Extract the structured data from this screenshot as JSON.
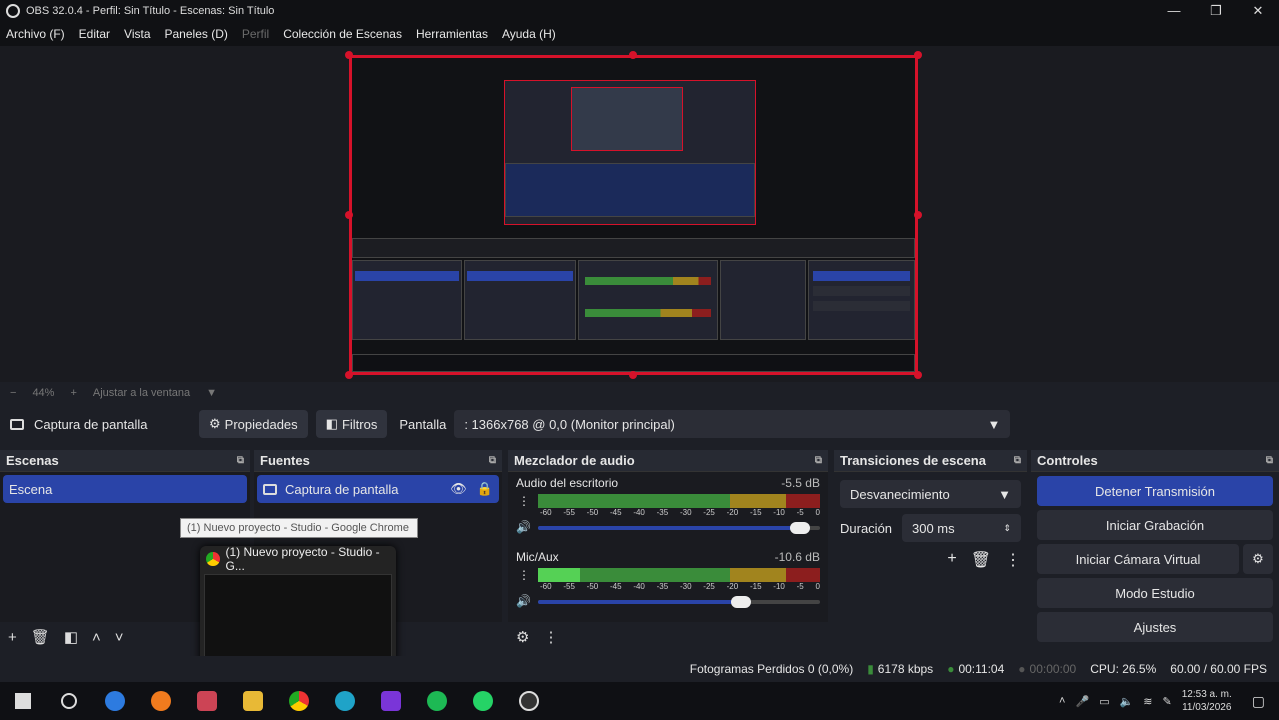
{
  "window": {
    "title": "OBS 32.0.4 - Perfil: Sin Título - Escenas: Sin Título",
    "controls": [
      "—",
      "❐",
      "✕"
    ]
  },
  "menu": {
    "items": [
      {
        "label": "Archivo (F)"
      },
      {
        "label": "Editar"
      },
      {
        "label": "Vista"
      },
      {
        "label": "Paneles (D)"
      },
      {
        "label": "Perfil"
      },
      {
        "label": "Colección de Escenas"
      },
      {
        "label": "Herramientas"
      },
      {
        "label": "Ayuda (H)"
      }
    ]
  },
  "preview": {
    "zoom_minus": "−",
    "zoom": "44%",
    "zoom_plus": "+",
    "fit": "Ajustar a la ventana",
    "accent": "#d6122a"
  },
  "sourcebar": {
    "source_name": "Captura de pantalla",
    "properties": "Propiedades",
    "filters": "Filtros",
    "screen_label": "Pantalla",
    "screen_value": ": 1366x768 @ 0,0 (Monitor principal)"
  },
  "docks": {
    "scenes": {
      "title": "Escenas",
      "items": [
        "Escena"
      ]
    },
    "sources": {
      "title": "Fuentes",
      "items": [
        "Captura de pantalla"
      ]
    },
    "mixer": {
      "title": "Mezclador de audio",
      "ticks": [
        "-60",
        "-55",
        "-50",
        "-45",
        "-40",
        "-35",
        "-30",
        "-25",
        "-20",
        "-15",
        "-10",
        "-5",
        "0"
      ],
      "tracks": [
        {
          "name": "Audio del escritorio",
          "db": "-5.5 dB",
          "level": 0.93
        },
        {
          "name": "Mic/Aux",
          "db": "-10.6 dB",
          "level": 0.72
        }
      ]
    },
    "transitions": {
      "title": "Transiciones de escena",
      "transition": "Desvanecimiento",
      "duration_label": "Duración",
      "duration_value": "300 ms"
    },
    "controls": {
      "title": "Controles",
      "buttons": [
        "Detener Transmisión",
        "Iniciar Grabación",
        "Iniciar Cámara Virtual",
        "Modo Estudio",
        "Ajustes"
      ]
    }
  },
  "tooltip": {
    "text": "(1) Nuevo proyecto - Studio - Google Chrome",
    "thumb_title": "(1) Nuevo proyecto - Studio - G..."
  },
  "status": {
    "dropped": "Fotogramas Perdidos 0 (0,0%)",
    "bitrate": "6178 kbps",
    "stream_time": "00:11:04",
    "rec_time": "00:00:00",
    "cpu": "CPU: 26.5%",
    "fps": "60.00 / 60.00 FPS"
  },
  "taskbar": {
    "time": "12:53 a. m.",
    "date": "11/03/2026"
  }
}
